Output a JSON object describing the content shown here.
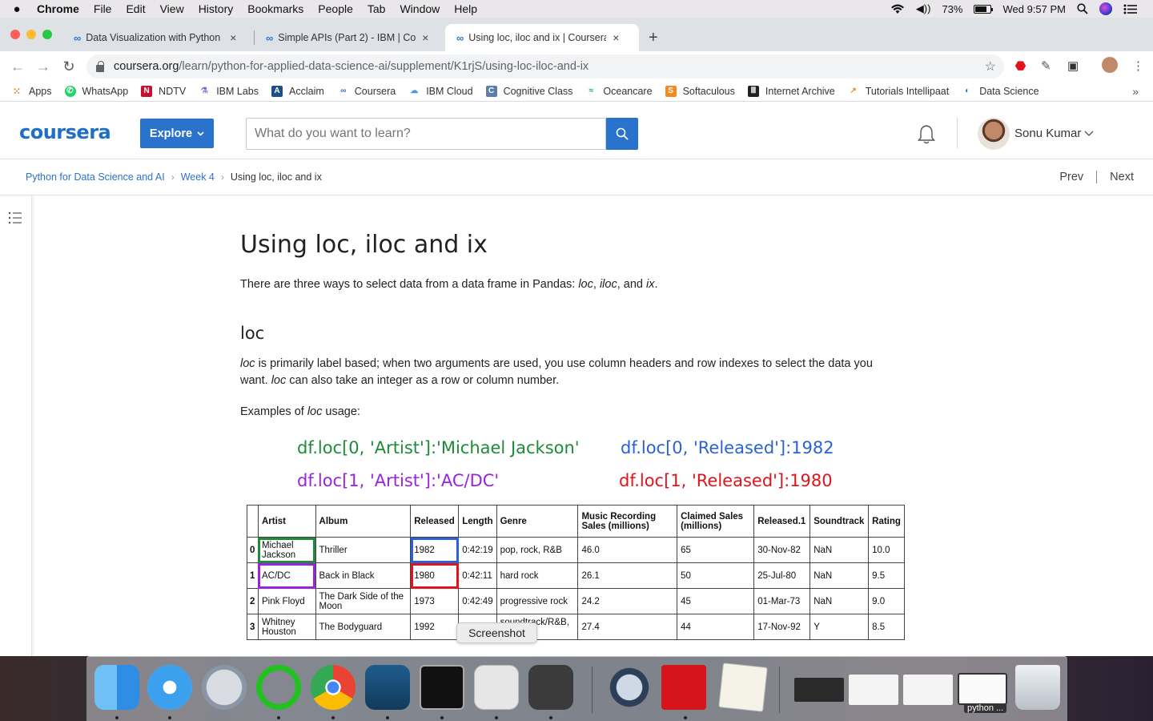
{
  "menubar": {
    "app": "Chrome",
    "items": [
      "File",
      "Edit",
      "View",
      "History",
      "Bookmarks",
      "People",
      "Tab",
      "Window",
      "Help"
    ],
    "battery": "73%",
    "clock": "Wed 9:57 PM"
  },
  "tabs": [
    {
      "title": "Data Visualization with Python",
      "close": "×"
    },
    {
      "title": "Simple APIs (Part 2) - IBM | Co",
      "close": "×"
    },
    {
      "title": "Using loc, iloc and ix | Coursera",
      "close": "×"
    }
  ],
  "newtab": "+",
  "omnibox": {
    "host": "coursera.org",
    "path": "/learn/python-for-applied-data-science-ai/supplement/K1rjS/using-loc-iloc-and-ix"
  },
  "bookmarks": [
    "Apps",
    "WhatsApp",
    "NDTV",
    "IBM Labs",
    "Acclaim",
    "Coursera",
    "IBM Cloud",
    "Cognitive Class",
    "Oceancare",
    "Softaculous",
    "Internet Archive",
    "Tutorials Intellipaat",
    "Data Science"
  ],
  "bookmarks_more": "»",
  "header": {
    "logo": "coursera",
    "explore": "Explore",
    "search_placeholder": "What do you want to learn?",
    "user": "Sonu Kumar"
  },
  "breadcrumb": {
    "course": "Python for Data Science and AI",
    "week": "Week 4",
    "current": "Using loc, iloc and ix"
  },
  "nav": {
    "prev": "Prev",
    "next": "Next"
  },
  "article": {
    "title": "Using loc, iloc and ix",
    "intro_prefix": "There are three ways to select data from a data frame in Pandas: ",
    "intro_loc": "loc",
    "intro_sep1": ", ",
    "intro_iloc": "iloc",
    "intro_sep2": ", and ",
    "intro_ix": "ix",
    "intro_end": ".",
    "section_heading": "loc",
    "loc_desc_em1": "loc",
    "loc_desc_1": " is primarily label based; when two arguments are used, you use column headers and row indexes to select the data you want. ",
    "loc_desc_em2": "loc",
    "loc_desc_2": " can also take an integer as a row or column number.",
    "examples_prefix": "Examples of ",
    "examples_em": "loc",
    "examples_suffix": " usage:"
  },
  "code_examples": [
    {
      "text": "df.loc[0, 'Artist']:'Michael Jackson'",
      "color": "#1e8a3a"
    },
    {
      "text": "df.loc[0, 'Released']:1982",
      "color": "#2a62d6"
    },
    {
      "text": "df.loc[1, 'Artist']:'AC/DC'",
      "color": "#9a22e0"
    },
    {
      "text": "df.loc[1, 'Released']:1980",
      "color": "#e0141b"
    }
  ],
  "table": {
    "headers": [
      "",
      "Artist",
      "Album",
      "Released",
      "Length",
      "Genre",
      "Music Recording Sales (millions)",
      "Claimed Sales (millions)",
      "Released.1",
      "Soundtrack",
      "Rating"
    ],
    "rows": [
      [
        "0",
        "Michael Jackson",
        "Thriller",
        "1982",
        "0:42:19",
        "pop, rock, R&B",
        "46.0",
        "65",
        "30-Nov-82",
        "NaN",
        "10.0"
      ],
      [
        "1",
        "AC/DC",
        "Back in Black",
        "1980",
        "0:42:11",
        "hard rock",
        "26.1",
        "50",
        "25-Jul-80",
        "NaN",
        "9.5"
      ],
      [
        "2",
        "Pink Floyd",
        "The Dark Side of the Moon",
        "1973",
        "0:42:49",
        "progressive rock",
        "24.2",
        "45",
        "01-Mar-73",
        "NaN",
        "9.0"
      ],
      [
        "3",
        "Whitney Houston",
        "The Bodyguard",
        "1992",
        "0:57:44",
        "soundtrack/R&B, soul, pop",
        "27.4",
        "44",
        "17-Nov-92",
        "Y",
        "8.5"
      ]
    ],
    "highlight_colors": {
      "green": "#1e8a3a",
      "blue": "#2a62d6",
      "purple": "#9a22e0",
      "red": "#e0141b"
    }
  },
  "tooltip": "Screenshot",
  "dock": {
    "apps": [
      "finder-icon",
      "safari-icon",
      "launchpad-icon",
      "activity-ring-icon",
      "chrome-icon",
      "mysql-workbench-icon",
      "terminal-icon",
      "screenshot-icon",
      "sublime-text-icon",
      "quicktime-icon",
      "acrobat-icon",
      "textedit-icon"
    ],
    "minimized_label": "python ..."
  },
  "colors": {
    "coursera_blue": "#2a73cc",
    "link": "#2a73cc"
  }
}
